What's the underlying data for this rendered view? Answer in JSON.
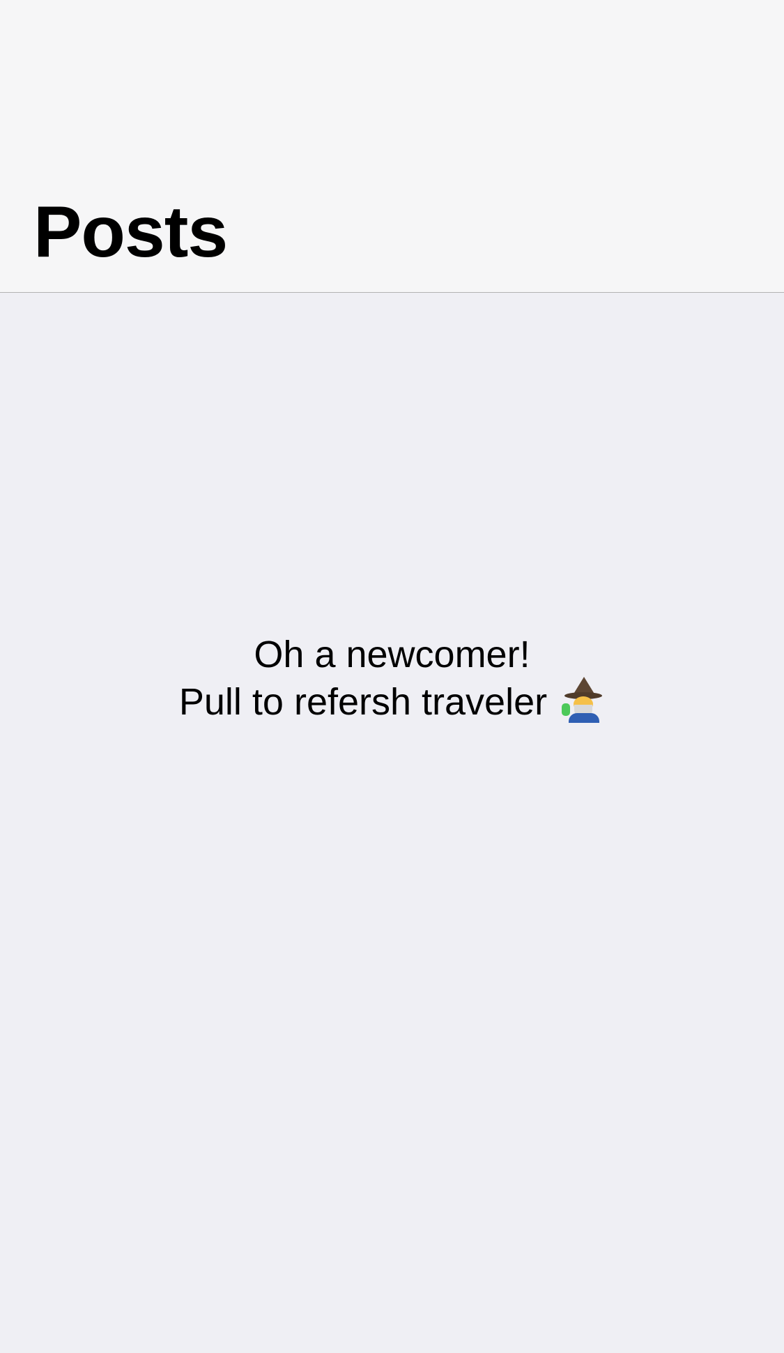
{
  "header": {
    "title": "Posts"
  },
  "empty_state": {
    "line1": "Oh a newcomer!",
    "line2": "Pull to refersh traveler",
    "icon": "wizard-icon"
  },
  "colors": {
    "nav_background": "#f6f6f7",
    "content_background": "#efeff4",
    "separator": "#b2b2b2",
    "text": "#000000"
  }
}
